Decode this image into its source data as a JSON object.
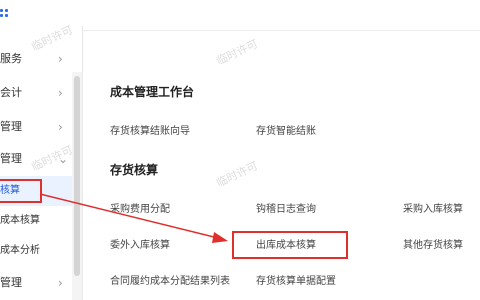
{
  "sidebar": {
    "items": [
      {
        "label": "服务",
        "sub": false
      },
      {
        "label": "会计",
        "sub": false
      },
      {
        "label": "管理",
        "sub": false
      },
      {
        "label": "管理",
        "sub": false
      },
      {
        "label": "核算",
        "sub": true
      },
      {
        "label": "成本核算",
        "sub": true
      },
      {
        "label": "成本分析",
        "sub": true
      },
      {
        "label": "管理",
        "sub": false
      }
    ]
  },
  "main": {
    "section1_title": "成本管理工作台",
    "section1_links": [
      "存货核算结账向导",
      "存货智能结账"
    ],
    "section2_title": "存货核算",
    "section2_links": [
      "采购费用分配",
      "钩稽日志查询",
      "采购入库核算",
      "委外入库核算",
      "出库成本核算",
      "其他存货核算",
      "合同履约成本分配结果列表",
      "存货核算单据配置"
    ]
  },
  "watermark": "临时许可"
}
